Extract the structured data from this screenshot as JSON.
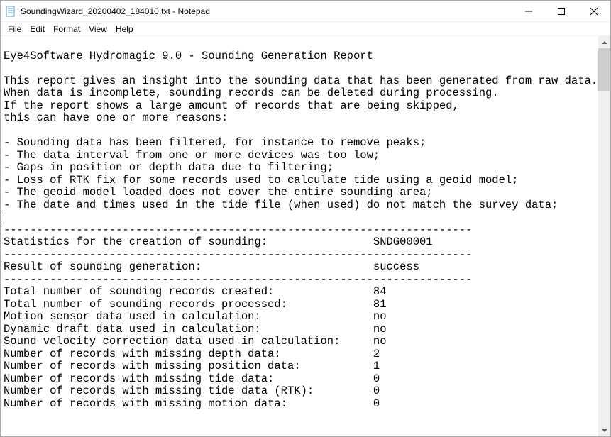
{
  "window": {
    "title": "SoundingWizard_20200402_184010.txt - Notepad"
  },
  "menu": {
    "file": "File",
    "edit": "Edit",
    "format": "Format",
    "view": "View",
    "help": "Help"
  },
  "doc": {
    "header": "Eye4Software Hydromagic 9.0 - Sounding Generation Report",
    "intro1": "This report gives an insight into the sounding data that has been generated from raw data.",
    "intro2": "When data is incomplete, sounding records can be deleted during processing.",
    "intro3": "If the report shows a large amount of records that are being skipped,",
    "intro4": "this can have one or more reasons:",
    "b1": "- Sounding data has been filtered, for instance to remove peaks;",
    "b2": "- The data interval from one or more devices was too low;",
    "b3": "- Gaps in position or depth data due to filtering;",
    "b4": "- Loss of RTK fix for some records used to calculate tide using a geoid model;",
    "b5": "- The geoid model loaded does not cover the entire sounding area;",
    "b6": "- The date and times used in the tide file (when used) do not match the survey data;",
    "sep": "-----------------------------------------------------------------------",
    "stats_hdr_label": "Statistics for the creation of sounding:",
    "stats_hdr_value": "SNDG00001",
    "result_label": "Result of sounding generation:",
    "result_value": "success",
    "r1_label": "Total number of sounding records created:",
    "r1_value": "84",
    "r2_label": "Total number of sounding records processed:",
    "r2_value": "81",
    "r3_label": "Motion sensor data used in calculation:",
    "r3_value": "no",
    "r4_label": "Dynamic draft data used in calculation:",
    "r4_value": "no",
    "r5_label": "Sound velocity correction data used in calculation:",
    "r5_value": "no",
    "r6_label": "Number of records with missing depth data:",
    "r6_value": "2",
    "r7_label": "Number of records with missing position data:",
    "r7_value": "1",
    "r8_label": "Number of records with missing tide data:",
    "r8_value": "0",
    "r9_label": "Number of records with missing tide data (RTK):",
    "r9_value": "0",
    "r10_label": "Number of records with missing motion data:",
    "r10_value": "0"
  }
}
